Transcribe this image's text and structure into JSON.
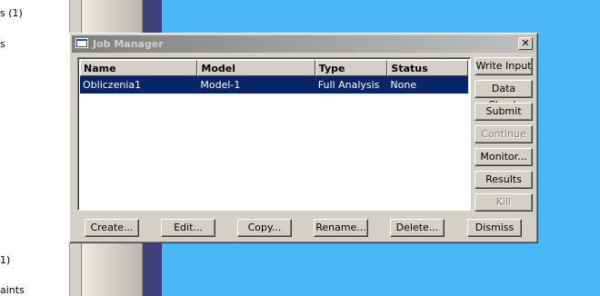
{
  "background": {
    "tree_fragments": [
      "s (1)",
      "s",
      "1)",
      "aints"
    ]
  },
  "dialog": {
    "title": "Job Manager",
    "close_label": "✕",
    "table": {
      "columns": [
        "Name",
        "Model",
        "Type",
        "Status"
      ],
      "rows": [
        {
          "name": "Obliczenia1",
          "model": "Model-1",
          "type": "Full Analysis",
          "status": "None",
          "selected": true
        }
      ]
    },
    "side_buttons": [
      {
        "label": "Write Input",
        "enabled": true
      },
      {
        "label": "Data Check",
        "enabled": true
      },
      {
        "label": "Submit",
        "enabled": true
      },
      {
        "label": "Continue",
        "enabled": false
      },
      {
        "label": "Monitor...",
        "enabled": true
      },
      {
        "label": "Results",
        "enabled": true
      },
      {
        "label": "Kill",
        "enabled": false
      }
    ],
    "bottom_buttons": [
      "Create...",
      "Edit...",
      "Copy...",
      "Rename...",
      "Delete...",
      "Dismiss"
    ]
  },
  "colors": {
    "desktop": "#4ab8f5",
    "selection": "#0a246a",
    "dialog_face": "#d4d0c8"
  }
}
